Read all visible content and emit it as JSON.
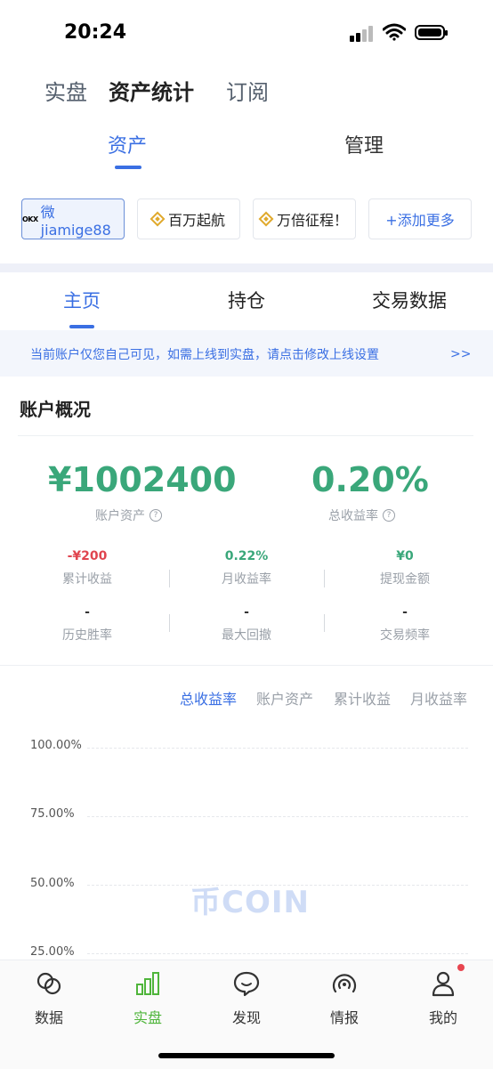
{
  "status_bar": {
    "time": "20:24"
  },
  "top_nav": {
    "items": [
      "实盘",
      "资产统计",
      "订阅"
    ]
  },
  "sub_tabs": [
    "资产",
    "管理"
  ],
  "accounts": [
    {
      "label": "微jiamige88",
      "icon": "okx-logo",
      "exchange_mark": "OKX"
    },
    {
      "label": "百万起航",
      "icon": "binance-icon"
    },
    {
      "label": "万倍征程！",
      "icon": "binance-icon"
    },
    {
      "label": "+添加更多",
      "icon": ""
    }
  ],
  "main_tabs": [
    "主页",
    "持仓",
    "交易数据"
  ],
  "notice": {
    "text": "当前账户仅您自己可见，如需上线到实盘，请点击修改上线设置",
    "arrow": ">>"
  },
  "overview": {
    "title": "账户概况",
    "total_assets": {
      "value": "¥1002400",
      "label": "账户资产"
    },
    "total_return": {
      "value": "0.20%",
      "label": "总收益率"
    },
    "stats_row1": [
      {
        "value": "-¥200",
        "label": "累计收益"
      },
      {
        "value": "0.22%",
        "label": "月收益率"
      },
      {
        "value": "¥0",
        "label": "提现金额"
      }
    ],
    "stats_row2": [
      {
        "value": "-",
        "label": "历史胜率"
      },
      {
        "value": "-",
        "label": "最大回撤"
      },
      {
        "value": "-",
        "label": "交易频率"
      }
    ]
  },
  "chart": {
    "tabs": [
      "总收益率",
      "账户资产",
      "累计收益",
      "月收益率"
    ],
    "yticks": [
      "100.00%",
      "75.00%",
      "50.00%",
      "25.00%"
    ],
    "watermark": "币COIN"
  },
  "bottom_nav": [
    {
      "label": "数据",
      "icon": "data-icon"
    },
    {
      "label": "实盘",
      "icon": "chart-bars-icon"
    },
    {
      "label": "发现",
      "icon": "chat-bubble-icon"
    },
    {
      "label": "情报",
      "icon": "radar-icon"
    },
    {
      "label": "我的",
      "icon": "user-icon"
    }
  ],
  "colors": {
    "accent": "#3a6fe3",
    "green": "#3aa77a",
    "red": "#e0454f",
    "nav_active": "#4fb53b"
  }
}
